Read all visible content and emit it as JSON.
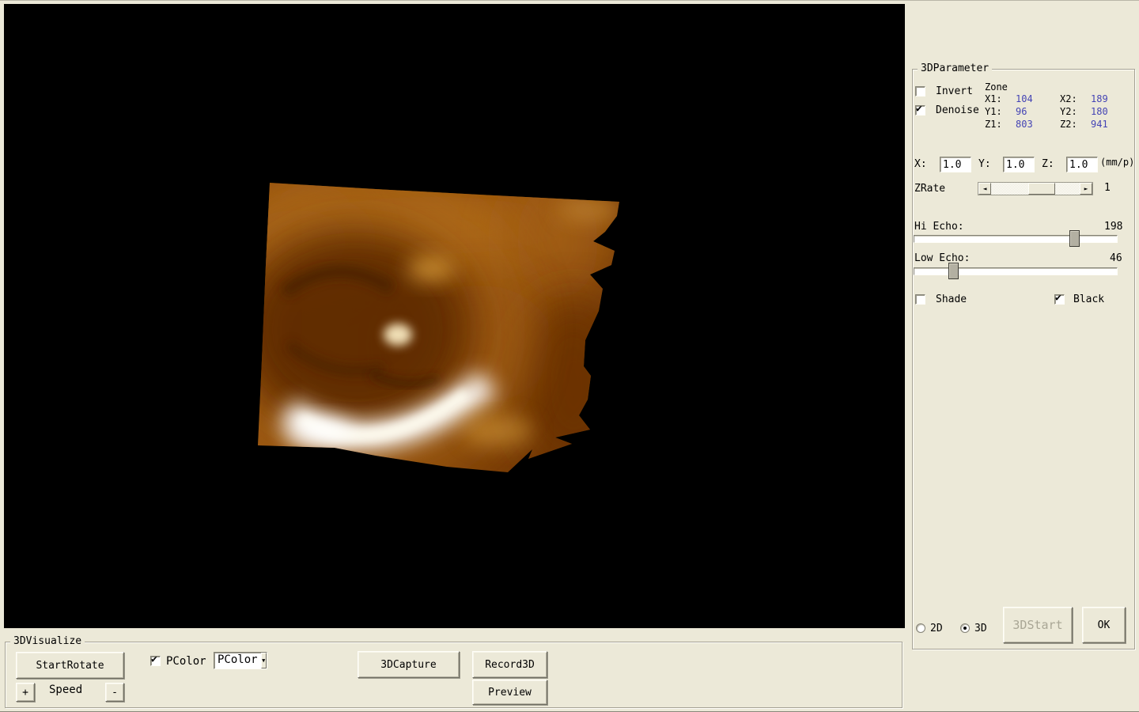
{
  "colors": {
    "panel_bg": "#ece9d8",
    "viewport_bg": "#000000",
    "zone_value_text": "#4444b4",
    "disabled_text": "#a9a695",
    "render_base": "#8a4708",
    "render_highlight": "#ffffff"
  },
  "param": {
    "title": "3DParameter",
    "invert_label": "Invert",
    "denoise_label": "Denoise",
    "zone": {
      "title": "Zone",
      "rows": [
        {
          "label_a": "X1:",
          "value_a": "104",
          "label_b": "X2:",
          "value_b": "189"
        },
        {
          "label_a": "Y1:",
          "value_a": "96",
          "label_b": "Y2:",
          "value_b": "180"
        },
        {
          "label_a": "Z1:",
          "value_a": "803",
          "label_b": "Z2:",
          "value_b": "941"
        }
      ]
    },
    "scale": {
      "x_label": "X:",
      "x_value": "1.0",
      "y_label": "Y:",
      "y_value": "1.0",
      "z_label": "Z:",
      "z_value": "1.0",
      "unit": "(mm/p)"
    },
    "zrate": {
      "label": "ZRate",
      "value": "1"
    },
    "hi_echo": {
      "label": "Hi Echo:",
      "value": "198"
    },
    "low_echo": {
      "label": "Low Echo:",
      "value": "46"
    },
    "shade_label": "Shade",
    "black_label": "Black",
    "radio_2d": "2D",
    "radio_3d": "3D",
    "start3d_button": "3DStart",
    "ok_button": "OK"
  },
  "visualize": {
    "title": "3DVisualize",
    "start_rotate_button": "StartRotate",
    "pcolor_check_label": "PColor",
    "pcolor_selected": "PColor",
    "capture_button": "3DCapture",
    "record_button": "Record3D",
    "preview_button": "Preview",
    "speed_plus": "+",
    "speed_label": "Speed",
    "speed_minus": "-"
  }
}
